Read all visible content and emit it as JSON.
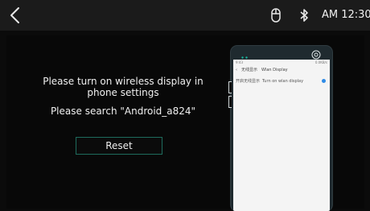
{
  "status_bar": {
    "time": "AM 12:30",
    "icons": [
      "back-arrow-icon",
      "mouse-icon",
      "bluetooth-icon"
    ]
  },
  "main": {
    "instruction_line1": "Please turn on wireless display in",
    "instruction_line2": "phone settings",
    "search_text": "Please search \"Android_a824\"",
    "reset_label": "Reset"
  },
  "phone_preview": {
    "status_time": "9:43",
    "status_info": "0.0KB/s",
    "header_cn": "无线显示",
    "header_en": "Wlan Display",
    "row_cn": "开启无线显示",
    "row_en": "Turn on wlan display"
  },
  "colors": {
    "topbar": "#1b1b1b",
    "background": "#080808",
    "button_border": "#1e6b5d",
    "toggle": "#2f8be6"
  }
}
